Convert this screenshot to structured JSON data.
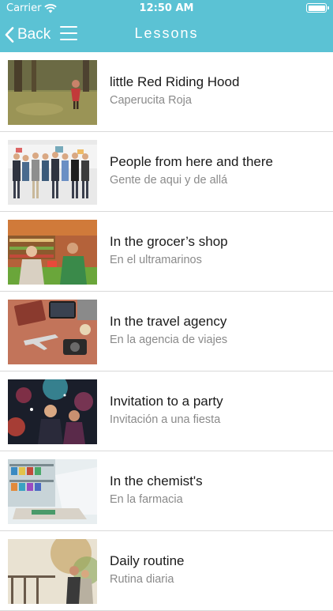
{
  "status_bar": {
    "carrier": "Carrier",
    "time": "12:50 AM"
  },
  "nav": {
    "back_label": "Back",
    "title": "Lessons"
  },
  "lessons": [
    {
      "title": "little Red Riding Hood",
      "subtitle": "Caperucita Roja",
      "image": "forest-girl-photo"
    },
    {
      "title": "People from here and there",
      "subtitle": "Gente de aqui y de allá",
      "image": "group-people-photo"
    },
    {
      "title": "In the grocer’s shop",
      "subtitle": "En el ultramarinos",
      "image": "grocery-shop-photo"
    },
    {
      "title": "In the travel agency",
      "subtitle": "En la agencia de viajes",
      "image": "travel-items-photo"
    },
    {
      "title": "Invitation to a party",
      "subtitle": "Invitación a una fiesta",
      "image": "party-photo"
    },
    {
      "title": "In the chemist's",
      "subtitle": "En la farmacia",
      "image": "pharmacy-photo"
    },
    {
      "title": "Daily routine",
      "subtitle": "Rutina diaria",
      "image": "couple-outdoors-photo"
    }
  ],
  "colors": {
    "header": "#5bc2d4",
    "title_text": "#1a1a1a",
    "subtitle_text": "#8a8a8a",
    "divider": "#d9d9d9"
  }
}
